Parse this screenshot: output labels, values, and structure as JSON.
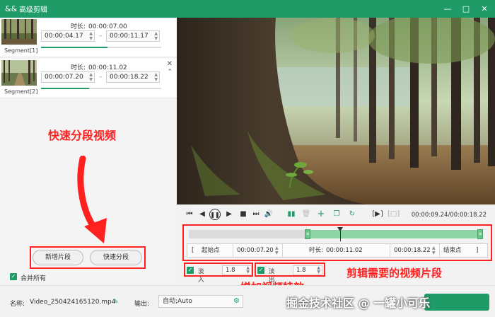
{
  "window": {
    "title": "高级剪辑",
    "logo_glyph": "&&"
  },
  "segments": [
    {
      "label": "Segment[1]",
      "duration_label": "时长:",
      "duration": "00:00:07.00",
      "start": "00:00:04.17",
      "end": "00:00:11.17",
      "progress": 0.55
    },
    {
      "label": "Segment[2]",
      "duration_label": "时长:",
      "duration": "00:00:11.02",
      "start": "00:00:07.20",
      "end": "00:00:18.22",
      "progress": 0.4
    }
  ],
  "left_panel": {
    "add_segment": "新增片段",
    "quick_segment": "快速分段",
    "merge_all": "合并所有"
  },
  "annotations": {
    "quick_split": "快速分段视频",
    "trim_segments": "剪辑需要的视频片段",
    "add_effects": "增加视频特效"
  },
  "player": {
    "time_display": "00:00:09.24/00:00:18.22",
    "range": {
      "start_btn": "起始点",
      "start": "00:00:07.20",
      "duration_label": "时长:",
      "duration": "00:00:11.02",
      "end": "00:00:18.22",
      "end_btn": "结束点"
    },
    "fade_in_label": "淡入",
    "fade_in": "1.8",
    "fade_out_label": "淡出",
    "fade_out": "1.8"
  },
  "bottom": {
    "name_label": "名称:",
    "filename": "Video_250424165120.mp4",
    "output_label": "输出:",
    "output_value": "自动;Auto",
    "watermark": "掘金技术社区 @ 一罐小可乐"
  },
  "colors": {
    "accent": "#1f9b68",
    "annotation": "#ff2020"
  }
}
